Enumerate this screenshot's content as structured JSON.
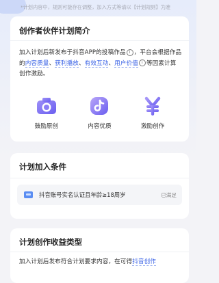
{
  "notice": "*计划内容中，规则可能存在调整，加入方式等请以【计划规则】为准",
  "intro": {
    "title": "创作者伙伴计划简介",
    "desc_pre": "加入计划后新发布于抖音APP的投稿作品",
    "desc_mid": "，平台会根据作品的",
    "tag_quality": "内容质量",
    "tag_play": "获利播放",
    "tag_interact": "有效互动",
    "tag_user": "用户价值",
    "desc_post": "等因素计算创作激励。",
    "sep": "、",
    "features": [
      {
        "label": "鼓励原创",
        "icon": "camera-icon"
      },
      {
        "label": "内容优质",
        "icon": "tiktok-icon"
      },
      {
        "label": "激励创作",
        "icon": "yen-icon"
      }
    ]
  },
  "conditions": {
    "title": "计划加入条件",
    "item_text": "抖音账号实名认证且年龄≥18周岁",
    "item_status": "已满足"
  },
  "revenue": {
    "title": "计划创作收益类型",
    "desc_pre": "加入计划后发布符合计划要求内容，在可得",
    "desc_link": "抖音创作"
  },
  "colors": {
    "accent": "#3b63e6",
    "icon_purple": "#7a6cf2"
  }
}
